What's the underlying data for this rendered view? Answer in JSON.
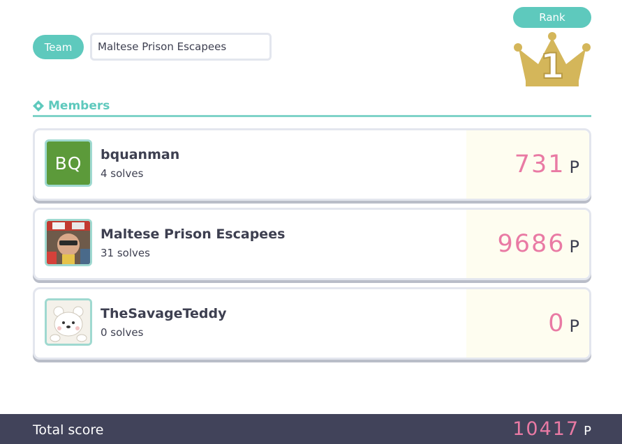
{
  "team": {
    "label": "Team",
    "name_value": "Maltese Prison Escapees"
  },
  "rank": {
    "label": "Rank",
    "value": "1",
    "icon": "crown-icon",
    "crown_color": "#d4b65a"
  },
  "members": {
    "heading": "Members",
    "items": [
      {
        "name": "bquanman",
        "solves": "4 solves",
        "score": "731",
        "unit": "P",
        "avatar_text": "BQ",
        "avatar_color": "#5c9a3a"
      },
      {
        "name": "Maltese Prison Escapees",
        "solves": "31 solves",
        "score": "9686",
        "unit": "P",
        "avatar": "photo"
      },
      {
        "name": "TheSavageTeddy",
        "solves": "0 solves",
        "score": "0",
        "unit": "P",
        "avatar": "polar-bear"
      }
    ]
  },
  "total": {
    "label": "Total score",
    "value": "10417",
    "unit": "P"
  },
  "colors": {
    "accent": "#5ec9bd",
    "score": "#e97aa4",
    "footer": "#41435a"
  }
}
